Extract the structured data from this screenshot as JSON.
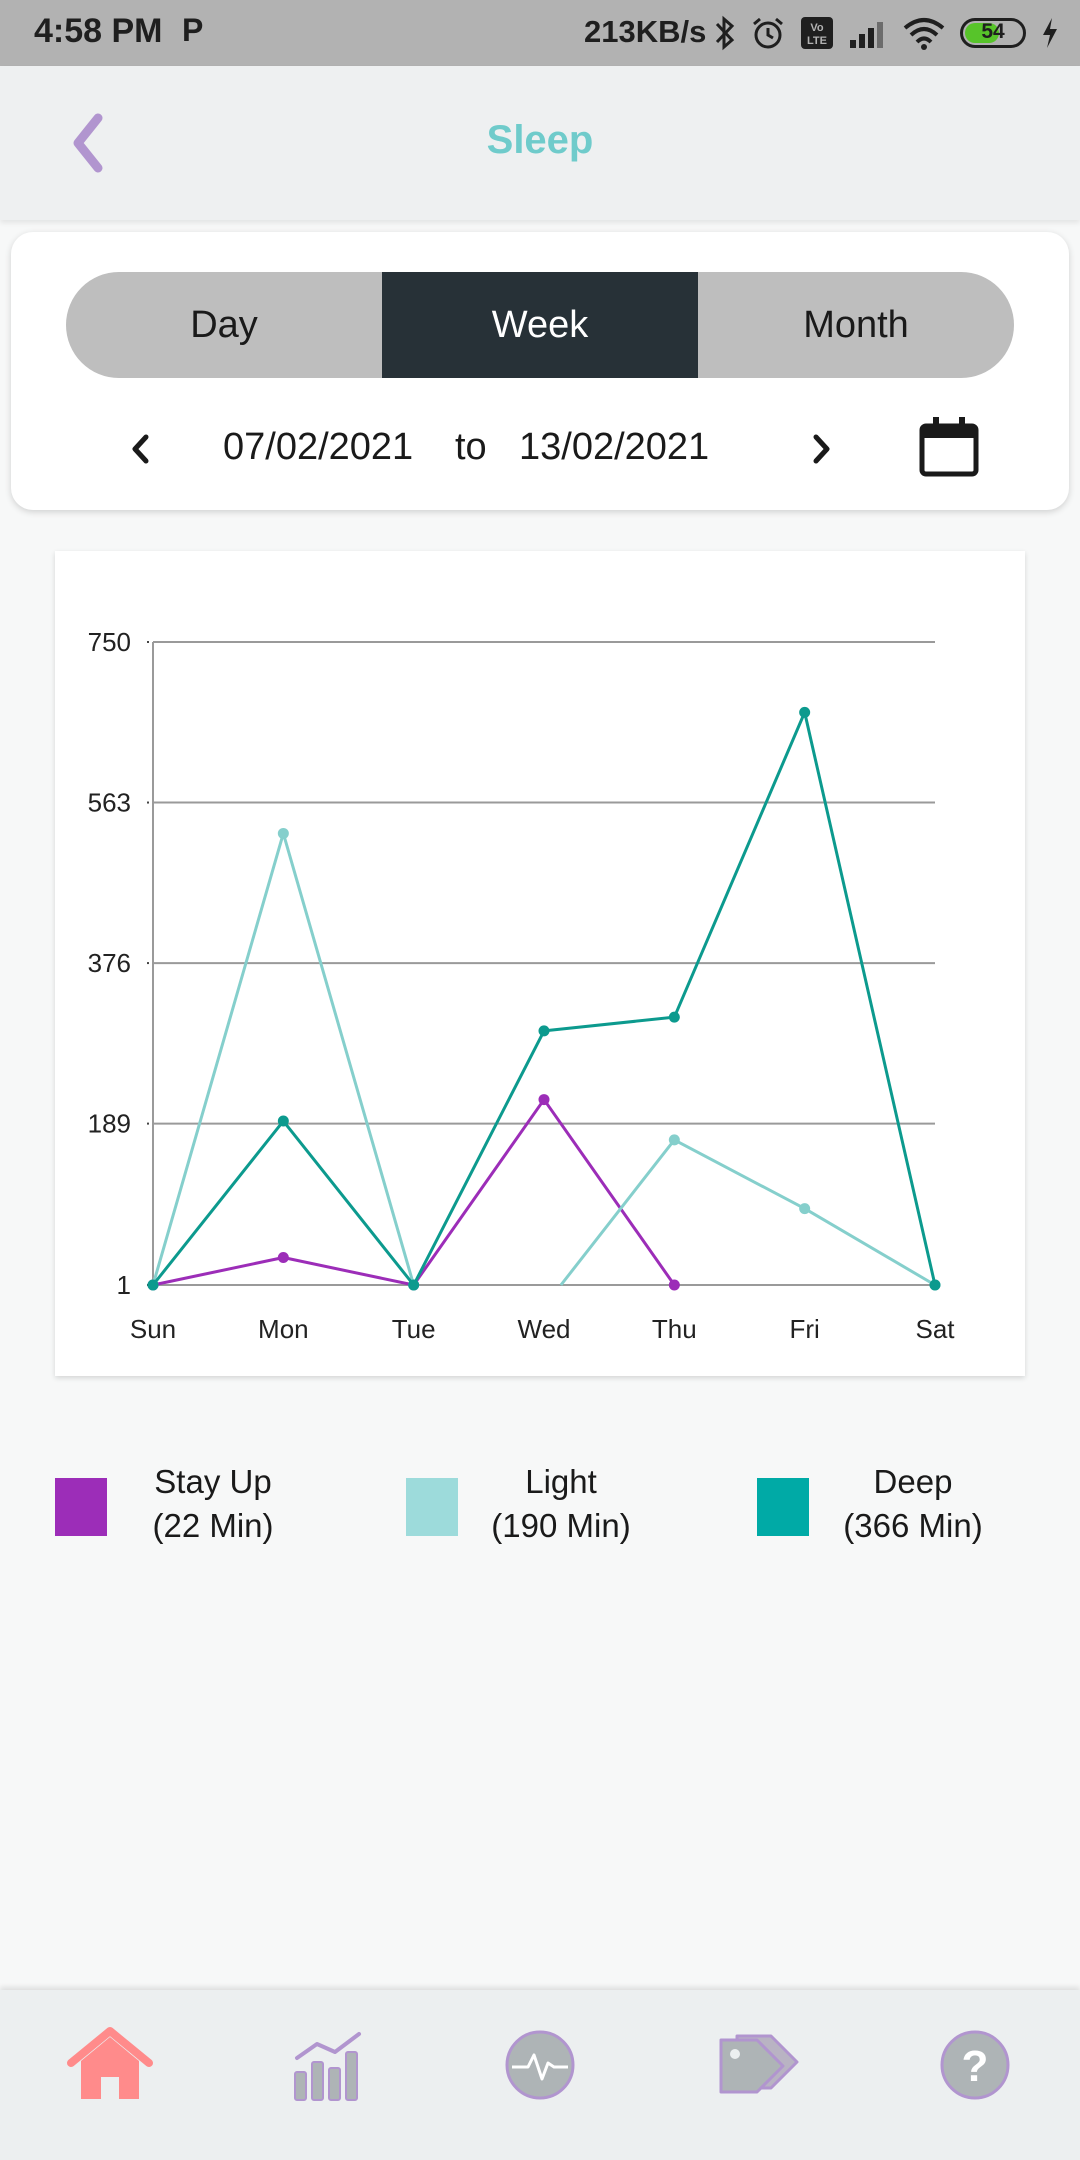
{
  "status_bar": {
    "time": "4:58 PM",
    "notification_icon": "P",
    "network_speed": "213KB/s",
    "battery_level": "54",
    "icons": [
      "bluetooth-icon",
      "alarm-icon",
      "volte-icon",
      "signal-icon",
      "wifi-icon",
      "battery-icon",
      "charging-icon"
    ]
  },
  "header": {
    "title": "Sleep",
    "back_icon": "chevron-left-icon"
  },
  "period": {
    "tabs": [
      {
        "label": "Day",
        "active": false
      },
      {
        "label": "Week",
        "active": true
      },
      {
        "label": "Month",
        "active": false
      }
    ],
    "from_date": "07/02/2021",
    "to_word": "to",
    "to_date": "13/02/2021"
  },
  "colors": {
    "title": "#6fcbcb",
    "active_tab": "#273137",
    "stay_up": "#9c2db8",
    "light": "#85cfcc",
    "deep": "#0c9a8e",
    "nav_home": "#ff8b8b",
    "nav_inactive": "#aeb4b6"
  },
  "chart_data": {
    "type": "line",
    "categories": [
      "Sun",
      "Mon",
      "Tue",
      "Wed",
      "Thu",
      "Fri",
      "Sat"
    ],
    "y_ticks": [
      "750",
      "563",
      "376",
      "189",
      "1"
    ],
    "ylim": [
      1,
      750
    ],
    "grid": true,
    "series": [
      {
        "name": "Stay Up",
        "color": "#9c2db8",
        "values": [
          1,
          33,
          1,
          217,
          1,
          null,
          null
        ]
      },
      {
        "name": "Light",
        "color": "#85cfcc",
        "values": [
          1,
          527,
          1,
          null,
          170,
          90,
          1
        ],
        "segment_after_null": {
          "from_value": 1,
          "from_index": 3.13
        }
      },
      {
        "name": "Deep",
        "color": "#0c9a8e",
        "values": [
          1,
          192,
          1,
          297,
          313,
          668,
          1
        ]
      }
    ]
  },
  "legend": [
    {
      "label": "Stay Up",
      "amount": "(22 Min)",
      "color": "#9c2db8"
    },
    {
      "label": "Light",
      "amount": "(190 Min)",
      "color": "#9ddbdb"
    },
    {
      "label": "Deep",
      "amount": "(366 Min)",
      "color": "#00aaa6"
    }
  ],
  "bottom_nav": {
    "items": [
      {
        "icon": "home-icon",
        "active": true
      },
      {
        "icon": "chart-icon",
        "active": false
      },
      {
        "icon": "heartbeat-icon",
        "active": false
      },
      {
        "icon": "tag-icon",
        "active": false
      },
      {
        "icon": "help-icon",
        "active": false
      }
    ]
  }
}
